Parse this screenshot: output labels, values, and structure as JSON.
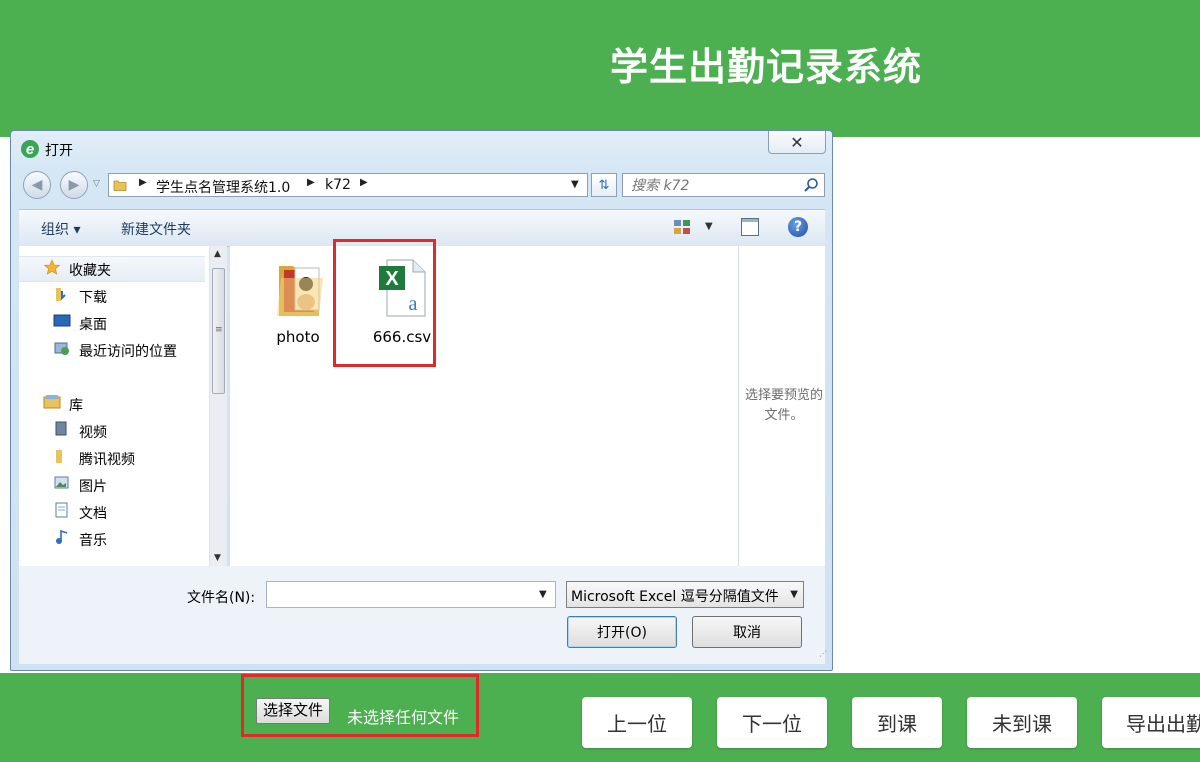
{
  "app": {
    "title": "学生出勤记录系统"
  },
  "file_input": {
    "button_label": "选择文件",
    "status": "未选择任何文件"
  },
  "actions": [
    {
      "label": "上一位"
    },
    {
      "label": "下一位"
    },
    {
      "label": "到课"
    },
    {
      "label": "未到课"
    },
    {
      "label": "导出出勤"
    }
  ],
  "dialog": {
    "title": "打开",
    "close_symbol": "✕",
    "address": {
      "segments": [
        "学生点名管理系统1.0",
        "k72"
      ]
    },
    "search": {
      "placeholder": "搜索 k72"
    },
    "toolbar": {
      "organize": "组织 ▾",
      "new_folder": "新建文件夹"
    },
    "nav": {
      "favorites": {
        "label": "收藏夹",
        "items": [
          "下载",
          "桌面",
          "最近访问的位置"
        ]
      },
      "libraries": {
        "label": "库",
        "items": [
          "视频",
          "腾讯视频",
          "图片",
          "文档",
          "音乐"
        ]
      }
    },
    "files": [
      {
        "name": "photo",
        "type": "folder"
      },
      {
        "name": "666.csv",
        "type": "excel-csv"
      }
    ],
    "preview_text": "选择要预览的文件。",
    "filename": {
      "label": "文件名(N):",
      "value": ""
    },
    "filter": {
      "selected": "Microsoft Excel 逗号分隔值文件"
    },
    "buttons": {
      "open": "打开(O)",
      "cancel": "取消"
    }
  }
}
